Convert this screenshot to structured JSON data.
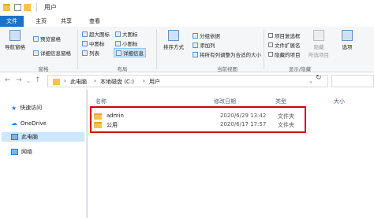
{
  "window": {
    "title": "用户"
  },
  "tabs": [
    "文件",
    "主页",
    "共享",
    "查看"
  ],
  "ribbon": {
    "pane": {
      "nav_pane": "导航窗格",
      "preview_pane": "预览窗格",
      "details_pane": "详细信息窗格",
      "group": "窗格"
    },
    "layout": {
      "items": [
        "超大图标",
        "大图标",
        "中图标",
        "小图标",
        "列表",
        "详细信息"
      ],
      "group": "布局"
    },
    "current_view": {
      "sort": "排序方式",
      "group_by": "分组依据",
      "add_columns": "添加列",
      "fit_columns": "将所有列调整为合适的大小",
      "group": "当前视图"
    },
    "show_hide": {
      "item_checkboxes": "项目复选框",
      "file_extensions": "文件扩展名",
      "hidden_items": "隐藏的项目",
      "hide_selected": "隐藏",
      "hide_selected_2": "所选项目",
      "options": "选项",
      "group": "显示/隐藏"
    }
  },
  "address": {
    "crumbs": [
      "此电脑",
      "本地磁盘 (C:)",
      "用户"
    ],
    "separator": "›"
  },
  "nav": {
    "quick_access": "快速访问",
    "onedrive": "OneDrive",
    "this_pc": "此电脑",
    "network": "网络"
  },
  "columns": {
    "name": "名称",
    "modified": "修改日期",
    "type": "类型",
    "size": "大小"
  },
  "files": [
    {
      "name": "admin",
      "modified": "2020/6/29 13:42",
      "type": "文件夹"
    },
    {
      "name": "公用",
      "modified": "2020/6/17 17:57",
      "type": "文件夹"
    }
  ]
}
